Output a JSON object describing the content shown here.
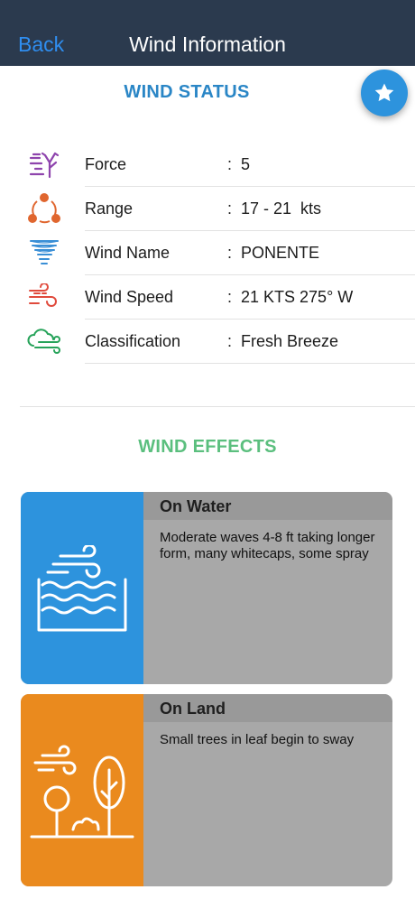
{
  "nav": {
    "back_label": "Back",
    "title": "Wind Information"
  },
  "status": {
    "title": "WIND STATUS",
    "favorite_icon": "star-icon",
    "rows": [
      {
        "icon": "force-icon",
        "label": "Force",
        "value": "5"
      },
      {
        "icon": "range-icon",
        "label": "Range",
        "value": "17 - 21  kts"
      },
      {
        "icon": "tornado-icon",
        "label": "Wind Name",
        "value": "PONENTE"
      },
      {
        "icon": "wind-speed-icon",
        "label": "Wind Speed",
        "value": "21 KTS 275° W"
      },
      {
        "icon": "cloud-wind-icon",
        "label": "Classification",
        "value": "Fresh Breeze"
      }
    ],
    "colon": ":"
  },
  "effects": {
    "title": "WIND EFFECTS",
    "water": {
      "heading": "On Water",
      "text": "Moderate waves 4-8 ft taking longer form, many whitecaps, some spray",
      "icon": "wind-waves-icon",
      "color": "#2d93dd"
    },
    "land": {
      "heading": "On Land",
      "text": "Small trees in leaf begin to sway",
      "icon": "wind-trees-icon",
      "color": "#ea8a1e"
    }
  },
  "colors": {
    "navbar": "#2b3a4e",
    "accent": "#2f8ef0",
    "status_title": "#2a86c6",
    "effects_title": "#5bbf7e"
  }
}
